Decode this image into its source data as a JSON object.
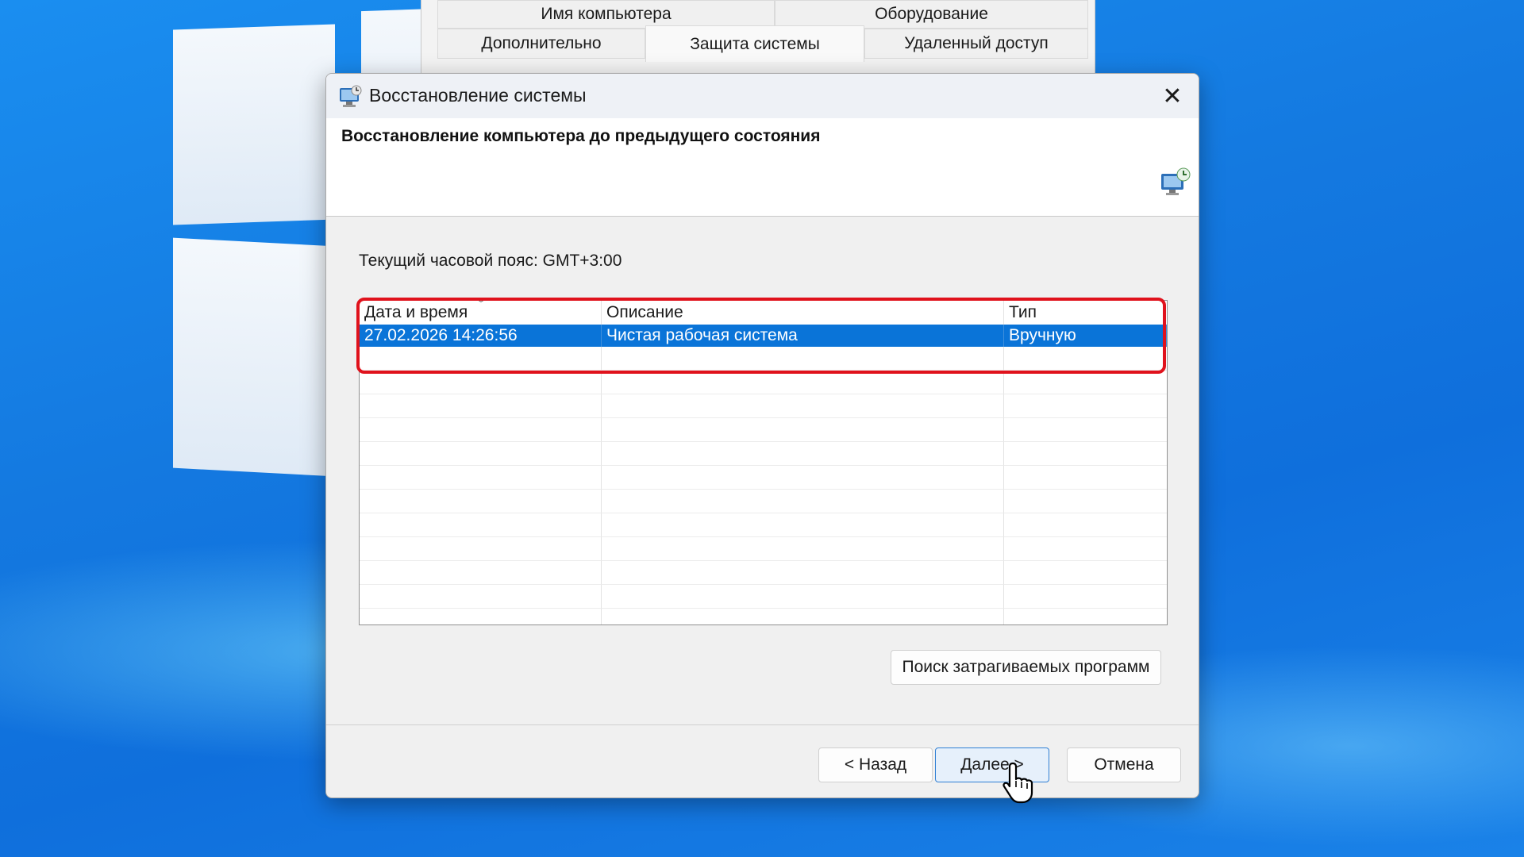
{
  "background_window": {
    "tabs_row1": [
      "Имя компьютера",
      "Оборудование"
    ],
    "tabs_row2": [
      "Дополнительно",
      "Защита системы",
      "Удаленный доступ"
    ],
    "active_tab": "Защита системы"
  },
  "dialog": {
    "title": "Восстановление системы",
    "close_icon": "close-icon",
    "header_title": "Восстановление компьютера до предыдущего состояния",
    "timezone_label": "Текущий часовой пояс: GMT+3:00",
    "columns": [
      "Дата и время",
      "Описание",
      "Тип"
    ],
    "sort_indicator": "chevron-down-icon",
    "rows": [
      {
        "date": "27.02.2026 14:26:56",
        "description": "Чистая рабочая система",
        "type": "Вручную",
        "selected": true
      }
    ],
    "scan_button": "Поиск затрагиваемых программ",
    "back_button": "< Назад",
    "next_button": "Далее >",
    "cancel_button": "Отмена"
  },
  "colors": {
    "selection": "#0a74d8",
    "highlight": "#e0121c",
    "desktop": "#1479e0"
  }
}
